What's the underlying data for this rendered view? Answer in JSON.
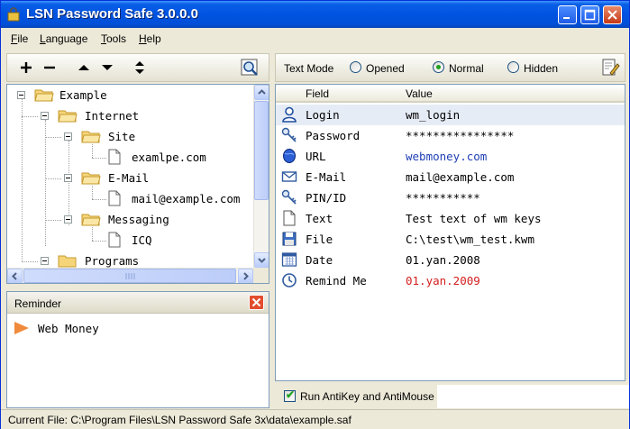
{
  "window": {
    "title": "LSN Password Safe 3.0.0.0"
  },
  "menu": [
    {
      "label": "File",
      "accel": "F",
      "rest": "ile"
    },
    {
      "label": "Language",
      "accel": "L",
      "rest": "anguage"
    },
    {
      "label": "Tools",
      "accel": "T",
      "rest": "ools"
    },
    {
      "label": "Help",
      "accel": "H",
      "rest": "elp"
    }
  ],
  "left_toolbar": {
    "icons": [
      "add-icon",
      "remove-icon",
      "move-up-icon",
      "move-down-icon",
      "sort-icon",
      "search-icon"
    ]
  },
  "tree": {
    "nodes": [
      {
        "label": "Example",
        "type": "folder",
        "level": 0
      },
      {
        "label": "Internet",
        "type": "folder",
        "level": 1
      },
      {
        "label": "Site",
        "type": "folder",
        "level": 2
      },
      {
        "label": "examlpe.com",
        "type": "item",
        "level": 3
      },
      {
        "label": "E-Mail",
        "type": "folder",
        "level": 2
      },
      {
        "label": "mail@example.com",
        "type": "item",
        "level": 3
      },
      {
        "label": "Messaging",
        "type": "folder",
        "level": 2
      },
      {
        "label": "ICQ",
        "type": "item",
        "level": 3
      },
      {
        "label": "Programs",
        "type": "folder",
        "level": 1
      }
    ]
  },
  "reminder": {
    "title": "Reminder",
    "items": [
      "Web Money"
    ]
  },
  "text_mode": {
    "label": "Text Mode",
    "options": [
      "Opened",
      "Normal",
      "Hidden"
    ],
    "selected": "Normal"
  },
  "grid": {
    "headers": {
      "field": "Field",
      "value": "Value"
    },
    "rows": [
      {
        "field": "Login",
        "value": "wm_login",
        "icon": "user-icon",
        "style": "normal"
      },
      {
        "field": "Password",
        "value": "****************",
        "icon": "key-icon",
        "style": "normal"
      },
      {
        "field": "URL",
        "value": "webmoney.com",
        "icon": "globe-icon",
        "style": "link"
      },
      {
        "field": "E-Mail",
        "value": "mail@example.com",
        "icon": "envelope-icon",
        "style": "normal"
      },
      {
        "field": "PIN/ID",
        "value": "***********",
        "icon": "key-icon",
        "style": "normal"
      },
      {
        "field": "Text",
        "value": "Test text of wm keys",
        "icon": "document-icon",
        "style": "normal"
      },
      {
        "field": "File",
        "value": "C:\\test\\wm_test.kwm",
        "icon": "floppy-icon",
        "style": "normal"
      },
      {
        "field": "Date",
        "value": "01.yan.2008",
        "icon": "calendar-icon",
        "style": "normal"
      },
      {
        "field": "Remind Me",
        "value": "01.yan.2009",
        "icon": "clock-icon",
        "style": "red"
      }
    ]
  },
  "options": {
    "antikey_label": "Run AntiKey and AntiMouse",
    "antikey_checked": true
  },
  "status": {
    "text": "Current File: C:\\Program Files\\LSN Password Safe 3x\\data\\example.saf"
  },
  "colors": {
    "titlebar": "#0053e1",
    "link": "#1f3fb5",
    "alert": "#d41e1e",
    "selected_row": "#e6ecf5"
  }
}
